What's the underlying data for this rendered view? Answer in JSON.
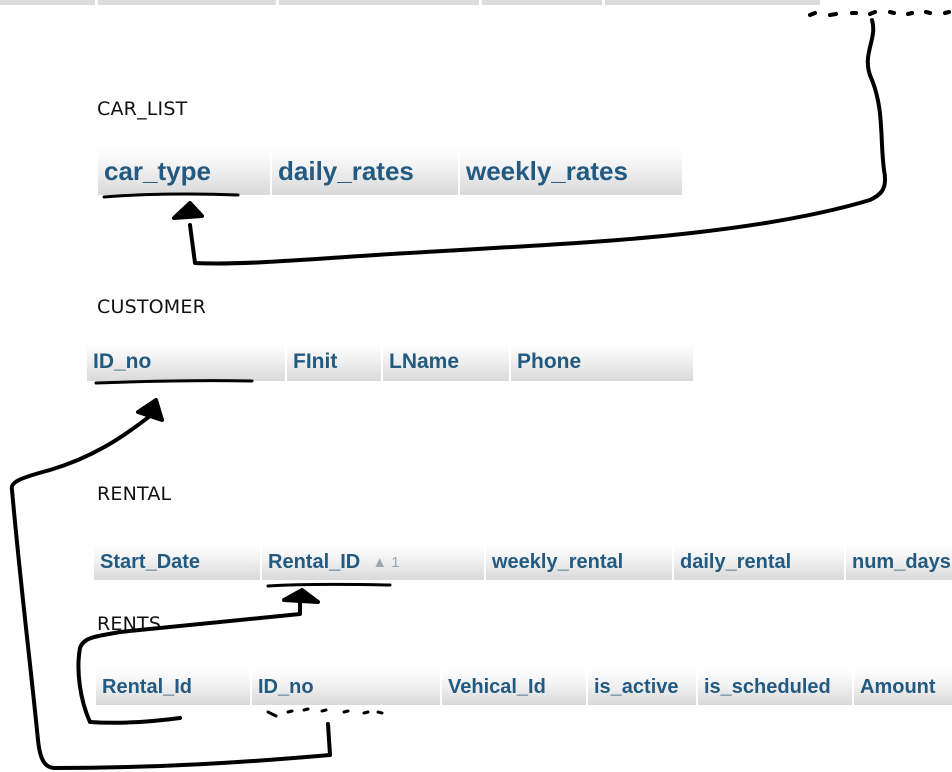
{
  "tables": {
    "car_list": {
      "name": "CAR_LIST",
      "columns": [
        "car_type",
        "daily_rates",
        "weekly_rates"
      ]
    },
    "customer": {
      "name": "CUSTOMER",
      "columns": [
        "ID_no",
        "FInit",
        "LName",
        "Phone"
      ]
    },
    "rental": {
      "name": "RENTAL",
      "columns": [
        "Start_Date",
        "Rental_ID",
        "weekly_rental",
        "daily_rental",
        "num_days"
      ],
      "sort_marker": "▲ 1"
    },
    "rents": {
      "name": "RENTS",
      "columns": [
        "Rental_Id",
        "ID_no",
        "Vehical_Id",
        "is_active",
        "is_scheduled",
        "Amount"
      ]
    }
  },
  "colors": {
    "header_text": "#235a81",
    "ink": "#000000"
  }
}
